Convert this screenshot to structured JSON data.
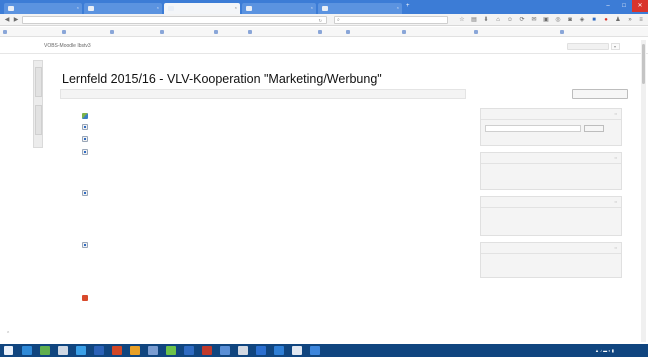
{
  "browser": {
    "tabs": [
      {
        "label": ""
      },
      {
        "label": ""
      },
      {
        "label": ""
      },
      {
        "label": ""
      },
      {
        "label": ""
      }
    ],
    "new_tab": "+",
    "window_controls": {
      "minimize": "–",
      "maximize": "□",
      "close": "✕"
    },
    "url": "",
    "search_placeholder": "",
    "bookmarks": [
      {
        "label": ""
      },
      {
        "label": ""
      },
      {
        "label": ""
      },
      {
        "label": ""
      },
      {
        "label": ""
      },
      {
        "label": ""
      },
      {
        "label": ""
      },
      {
        "label": ""
      },
      {
        "label": ""
      },
      {
        "label": ""
      },
      {
        "label": ""
      }
    ]
  },
  "moodle": {
    "site_name": "VOBS-Moodle Ibstv3",
    "user": "",
    "dock": {
      "navigation": "",
      "administration": ""
    },
    "page_title": "Lernfeld 2015/16 - VLV-Kooperation \"Marketing/Werbung\"",
    "breadcrumb": [
      {
        "label": ""
      },
      {
        "label": ""
      },
      {
        "label": ""
      },
      {
        "label": ""
      }
    ],
    "edit_button": "",
    "resources": [
      {
        "title": "",
        "type": "forum"
      },
      {
        "title": "",
        "type": "file"
      },
      {
        "title": "",
        "type": "file"
      },
      {
        "title": "",
        "type": "file",
        "lines": [
          "",
          "",
          "",
          ""
        ]
      },
      {
        "title": "",
        "type": "file",
        "lines": [
          "",
          "",
          "",
          ""
        ]
      },
      {
        "title": "",
        "type": "file",
        "lines": [
          "",
          "",
          "",
          ""
        ]
      },
      {
        "title": "",
        "type": "pdf",
        "lines": [
          "",
          "",
          "",
          ""
        ]
      }
    ],
    "blocks": {
      "search_forums": {
        "heading": "",
        "go": "",
        "advanced": ""
      },
      "latest_news": {
        "heading": "",
        "add": "",
        "none": ""
      },
      "upcoming_events": {
        "heading": "",
        "none": "",
        "goto": "",
        "new_event": ""
      },
      "recent_activity": {
        "heading": "",
        "since": "",
        "report": "",
        "nothing": ""
      }
    }
  },
  "taskbar": {
    "clock_time": "",
    "clock_date": ""
  }
}
